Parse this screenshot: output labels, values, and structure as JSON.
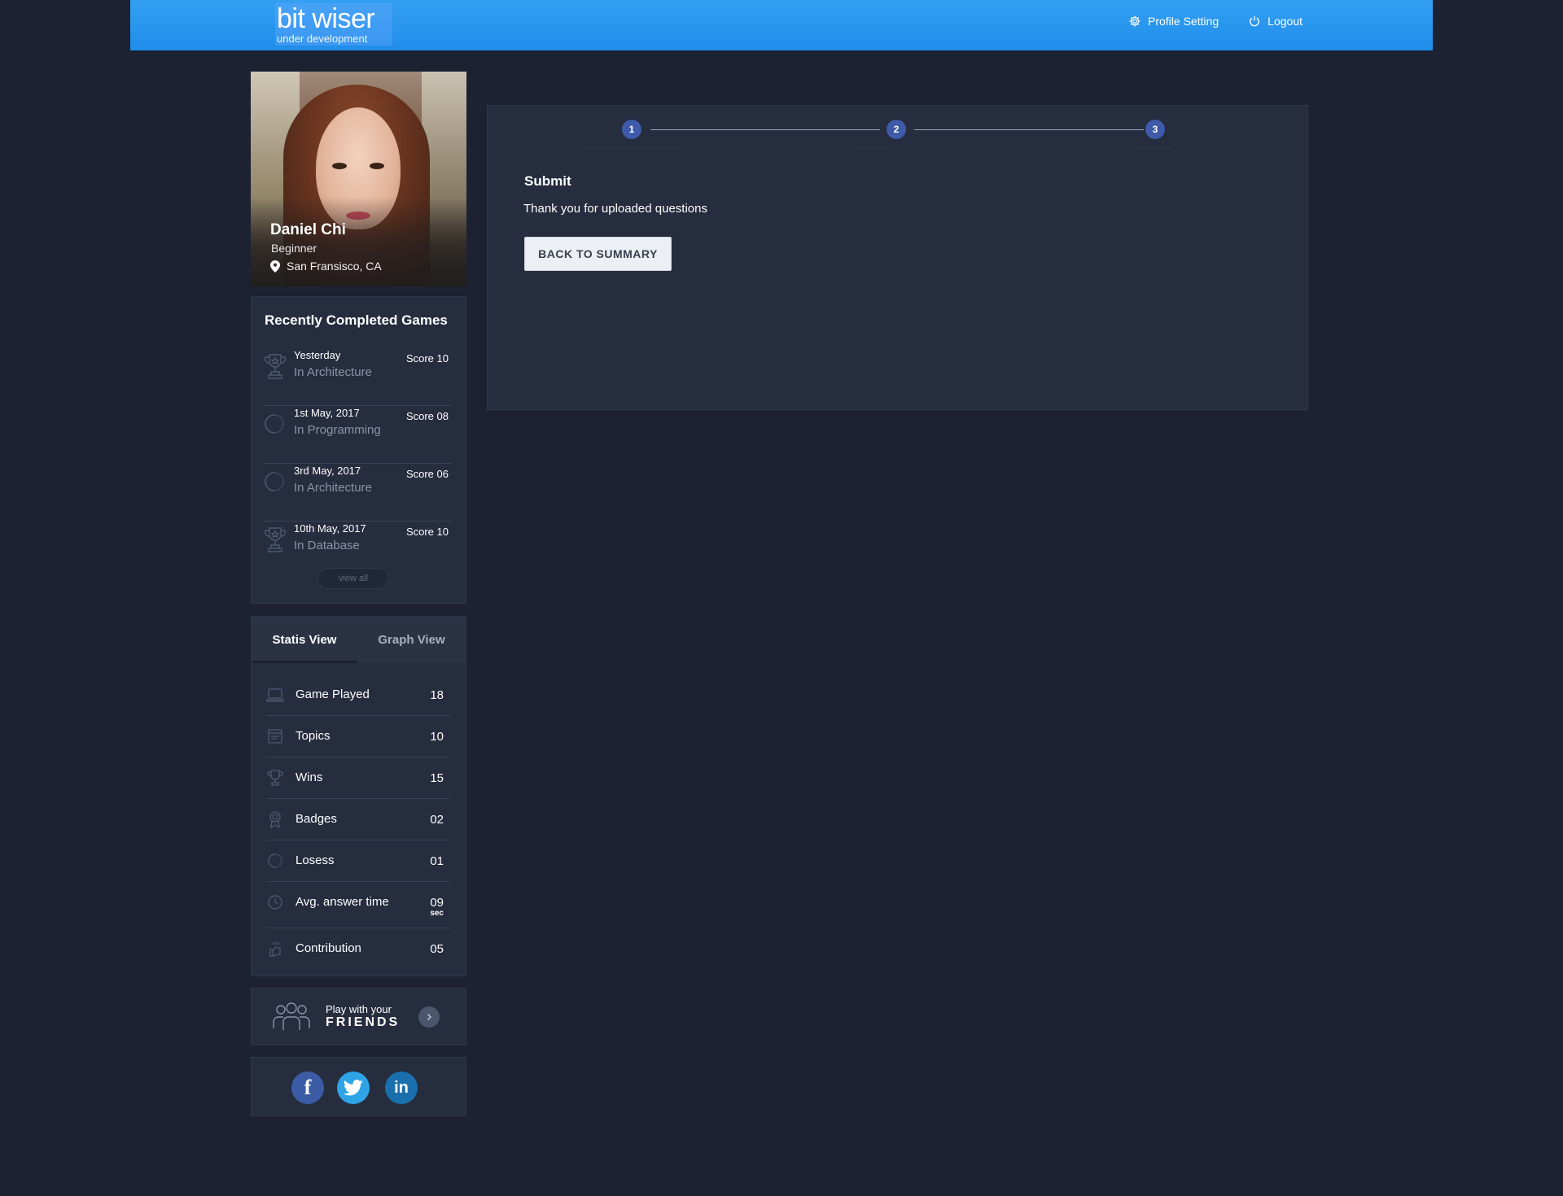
{
  "header": {
    "logo_title": "bit wiser",
    "logo_subtitle": "under development",
    "nav": {
      "profile_setting": "Profile Setting",
      "logout": "Logout"
    }
  },
  "profile": {
    "name": "Daniel Chi",
    "level": "Beginner",
    "location": "San Fransisco, CA"
  },
  "recent_games": {
    "title": "Recently Completed Games",
    "items": [
      {
        "date": "Yesterday",
        "category": "In Architecture",
        "score": "Score 10",
        "icon": "trophy-icon"
      },
      {
        "date": "1st May, 2017",
        "category": "In Programming",
        "score": "Score 08",
        "icon": "loss-circle-icon"
      },
      {
        "date": "3rd May, 2017",
        "category": "In Architecture",
        "score": "Score 06",
        "icon": "loss-circle-icon"
      },
      {
        "date": "10th May, 2017",
        "category": "In Database",
        "score": "Score 10",
        "icon": "trophy-icon"
      }
    ],
    "view_all": "view all"
  },
  "stats": {
    "tabs": [
      "Statis View",
      "Graph View"
    ],
    "active_tab": "Statis View",
    "rows": [
      {
        "label": "Game Played",
        "value": "18",
        "unit": "",
        "icon": "laptop-icon"
      },
      {
        "label": "Topics",
        "value": "10",
        "unit": "",
        "icon": "topics-icon"
      },
      {
        "label": "Wins",
        "value": "15",
        "unit": "",
        "icon": "trophy-icon"
      },
      {
        "label": "Badges",
        "value": "02",
        "unit": "",
        "icon": "badge-icon"
      },
      {
        "label": "Losess",
        "value": "01",
        "unit": "",
        "icon": "loss-circle-icon"
      },
      {
        "label": "Avg. answer time",
        "value": "09",
        "unit": "sec",
        "icon": "clock-icon"
      },
      {
        "label": "Contribution",
        "value": "05",
        "unit": "",
        "icon": "contribution-icon"
      }
    ]
  },
  "friends": {
    "line1": "Play with your",
    "line2": "FRIENDS"
  },
  "social": {
    "facebook": "f",
    "twitter": "twitter-icon",
    "linkedin": "in"
  },
  "main": {
    "steps": [
      "1",
      "2",
      "3"
    ],
    "current_step": "3",
    "title": "Submit",
    "message": "Thank you for uploaded questions",
    "button": "BACK TO SUMMARY"
  },
  "colors": {
    "background": "#1c2232",
    "header": "#1f8de9",
    "panel": "#252d3e",
    "step": "#3e5aa8"
  }
}
